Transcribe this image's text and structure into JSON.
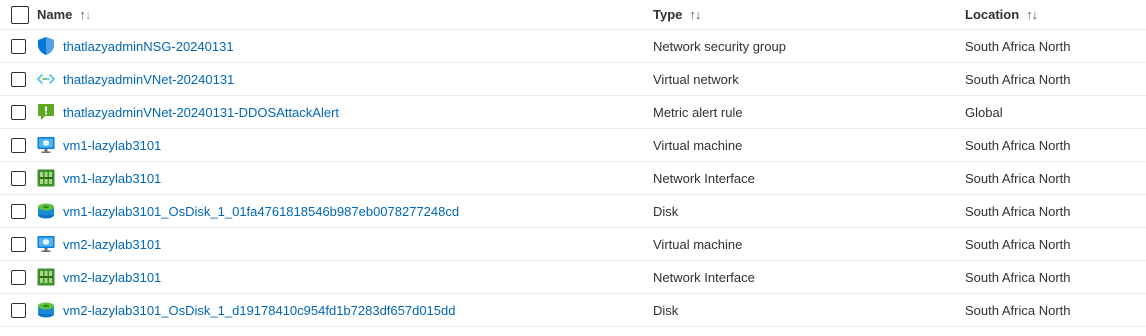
{
  "columns": {
    "name": "Name",
    "type": "Type",
    "location": "Location"
  },
  "rows": [
    {
      "name": "thatlazyadminNSG-20240131",
      "type": "Network security group",
      "location": "South Africa North",
      "icon": "network-security-group-icon"
    },
    {
      "name": "thatlazyadminVNet-20240131",
      "type": "Virtual network",
      "location": "South Africa North",
      "icon": "virtual-network-icon"
    },
    {
      "name": "thatlazyadminVNet-20240131-DDOSAttackAlert",
      "type": "Metric alert rule",
      "location": "Global",
      "icon": "alert-rule-icon"
    },
    {
      "name": "vm1-lazylab3101",
      "type": "Virtual machine",
      "location": "South Africa North",
      "icon": "virtual-machine-icon"
    },
    {
      "name": "vm1-lazylab3101",
      "type": "Network Interface",
      "location": "South Africa North",
      "icon": "network-interface-icon"
    },
    {
      "name": "vm1-lazylab3101_OsDisk_1_01fa4761818546b987eb0078277248cd",
      "type": "Disk",
      "location": "South Africa North",
      "icon": "disk-icon"
    },
    {
      "name": "vm2-lazylab3101",
      "type": "Virtual machine",
      "location": "South Africa North",
      "icon": "virtual-machine-icon"
    },
    {
      "name": "vm2-lazylab3101",
      "type": "Network Interface",
      "location": "South Africa North",
      "icon": "network-interface-icon"
    },
    {
      "name": "vm2-lazylab3101_OsDisk_1_d19178410c954fd1b7283df657d015dd",
      "type": "Disk",
      "location": "South Africa North",
      "icon": "disk-icon"
    }
  ],
  "colors": {
    "link": "#0067b8",
    "text": "#323130",
    "divider": "#edebe9"
  }
}
